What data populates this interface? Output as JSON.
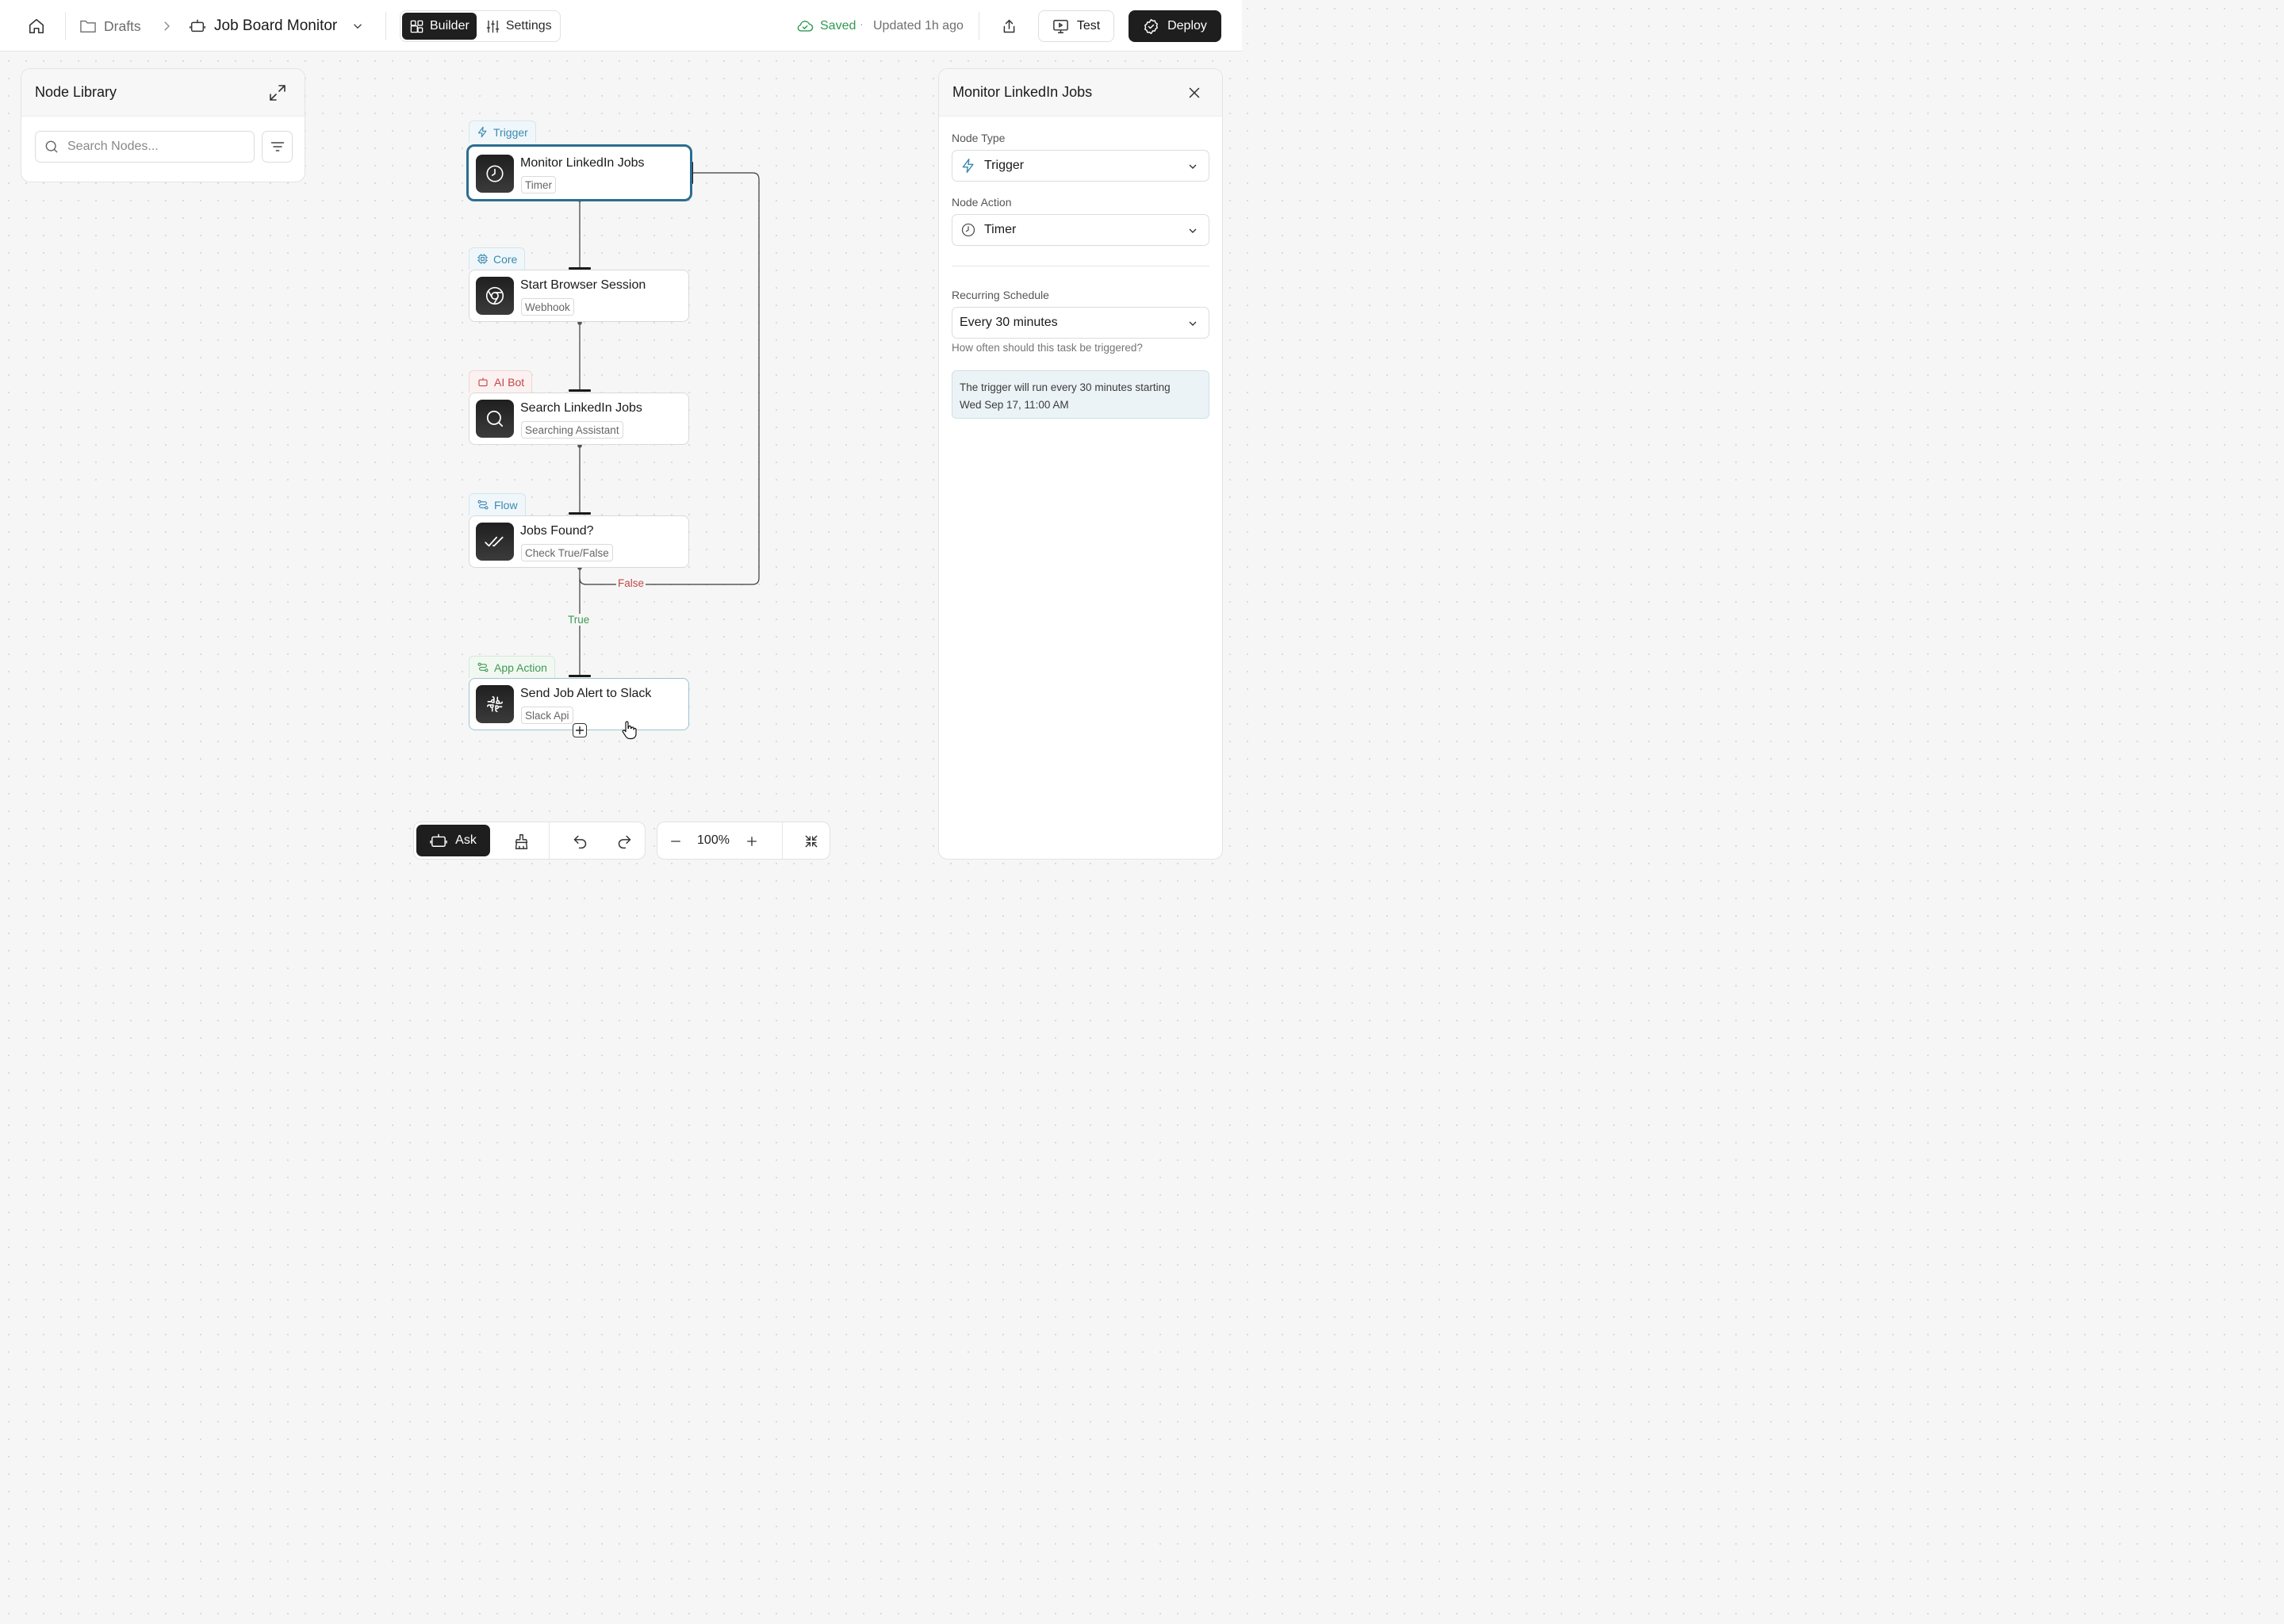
{
  "header": {
    "breadcrumb_folder": "Drafts",
    "project_name": "Job Board Monitor",
    "tabs": [
      "Builder",
      "Settings"
    ],
    "saved_label": "Saved",
    "updated_label": "Updated 1h ago",
    "test_label": "Test",
    "deploy_label": "Deploy"
  },
  "library": {
    "title": "Node Library",
    "search_placeholder": "Search Nodes..."
  },
  "nodes": [
    {
      "tag": "Trigger",
      "title": "Monitor LinkedIn Jobs",
      "sub": "Timer"
    },
    {
      "tag": "Core",
      "title": "Start Browser Session",
      "sub": "Webhook"
    },
    {
      "tag": "AI Bot",
      "title": "Search LinkedIn Jobs",
      "sub": "Searching Assistant"
    },
    {
      "tag": "Flow",
      "title": "Jobs Found?",
      "sub": "Check True/False"
    },
    {
      "tag": "App Action",
      "title": "Send Job Alert to Slack",
      "sub": "Slack Api"
    }
  ],
  "branches": {
    "false_label": "False",
    "true_label": "True"
  },
  "details": {
    "title": "Monitor LinkedIn Jobs",
    "node_type_label": "Node Type",
    "node_type_value": "Trigger",
    "node_action_label": "Node Action",
    "node_action_value": "Timer",
    "schedule_label": "Recurring Schedule",
    "schedule_value": "Every 30 minutes",
    "schedule_hint": "How often should this task be triggered?",
    "info_line1": "The trigger will run every 30 minutes starting",
    "info_line2": "Wed Sep 17, 11:00 AM"
  },
  "toolbar": {
    "ask_label": "Ask",
    "zoom": "100%"
  },
  "colors": {
    "selected_border": "#2b6e91",
    "saved_green": "#2f9a51",
    "false_red": "#c24848",
    "true_green": "#3f9a53",
    "tag_blue": "#3a8ab0"
  }
}
